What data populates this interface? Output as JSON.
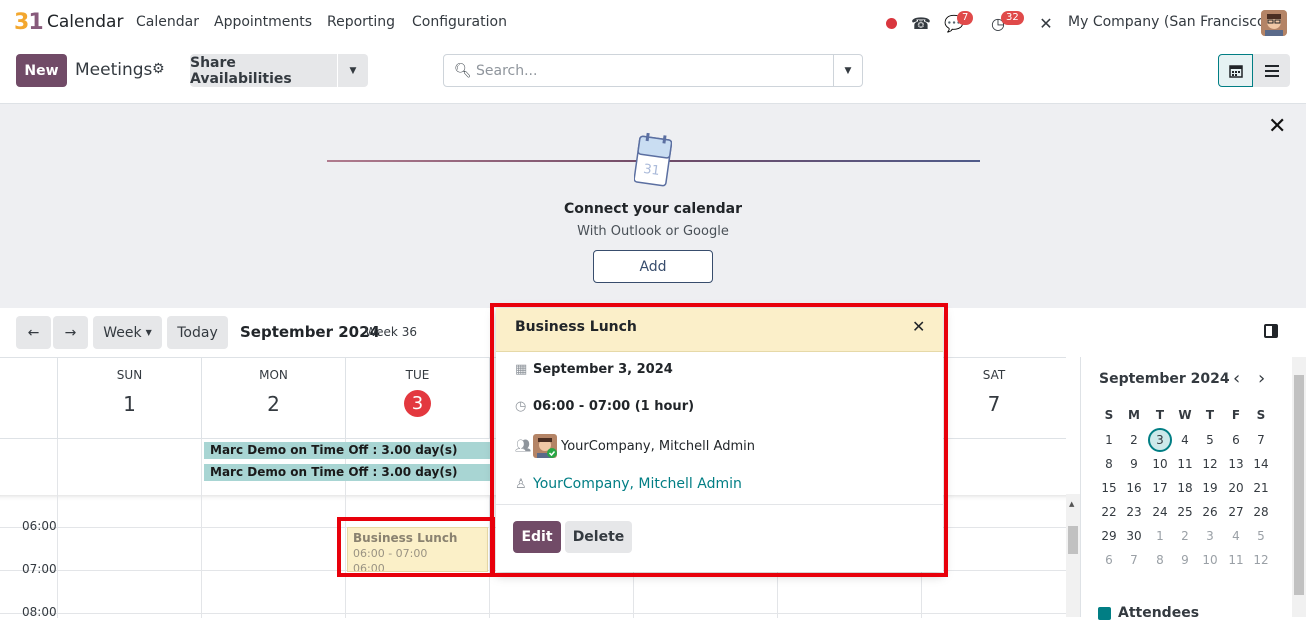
{
  "app": {
    "name": "Calendar"
  },
  "nav": {
    "menu": [
      "Calendar",
      "Appointments",
      "Reporting",
      "Configuration"
    ],
    "messages_badge": "7",
    "activities_badge": "32",
    "company": "My Company (San Francisco)"
  },
  "control": {
    "new_label": "New",
    "title": "Meetings",
    "share_label": "Share Availabilities",
    "search_placeholder": "Search..."
  },
  "banner": {
    "title": "Connect your calendar",
    "subtitle": "With Outlook or Google",
    "add_label": "Add",
    "calendar_icon_number": "31"
  },
  "toolbar": {
    "prev_icon": "←",
    "next_icon": "→",
    "scale_label": "Week",
    "today_label": "Today",
    "period_label": "September 2024",
    "week_label": "Week 36"
  },
  "days": [
    {
      "name": "SUN",
      "num": "1"
    },
    {
      "name": "MON",
      "num": "2"
    },
    {
      "name": "TUE",
      "num": "3",
      "today": true
    },
    {
      "name": "",
      "num": ""
    },
    {
      "name": "",
      "num": ""
    },
    {
      "name": "",
      "num": ""
    },
    {
      "name": "SAT",
      "num": "7"
    }
  ],
  "allday_events": [
    {
      "title": "Marc Demo on Time Off : 3.00 day(s)"
    },
    {
      "title": "Marc Demo on Time Off : 3.00 day(s)"
    }
  ],
  "time_labels": [
    "06:00",
    "07:00",
    "08:00"
  ],
  "event": {
    "title": "Business Lunch",
    "time": "06:00 - 07:00",
    "time_cut": "06:00"
  },
  "popover": {
    "title": "Business Lunch",
    "date": "September 3, 2024",
    "time": "06:00 - 07:00 (1 hour)",
    "attendees": "YourCompany, Mitchell Admin",
    "organizer": "YourCompany, Mitchell Admin",
    "edit_label": "Edit",
    "delete_label": "Delete"
  },
  "mini_calendar": {
    "title": "September 2024",
    "dow": [
      "S",
      "M",
      "T",
      "W",
      "T",
      "F",
      "S"
    ],
    "weeks": [
      [
        "1",
        "2",
        "3",
        "4",
        "5",
        "6",
        "7"
      ],
      [
        "8",
        "9",
        "10",
        "11",
        "12",
        "13",
        "14"
      ],
      [
        "15",
        "16",
        "17",
        "18",
        "19",
        "20",
        "21"
      ],
      [
        "22",
        "23",
        "24",
        "25",
        "26",
        "27",
        "28"
      ],
      [
        "29",
        "30",
        "1",
        "2",
        "3",
        "4",
        "5"
      ],
      [
        "6",
        "7",
        "8",
        "9",
        "10",
        "11",
        "12"
      ]
    ],
    "attendees_label": "Attendees"
  },
  "colors": {
    "primary": "#714b67",
    "accent": "#017e84",
    "allday": "#a8d5d3",
    "event": "#fbf0c8",
    "highlight": "#e8000b"
  }
}
